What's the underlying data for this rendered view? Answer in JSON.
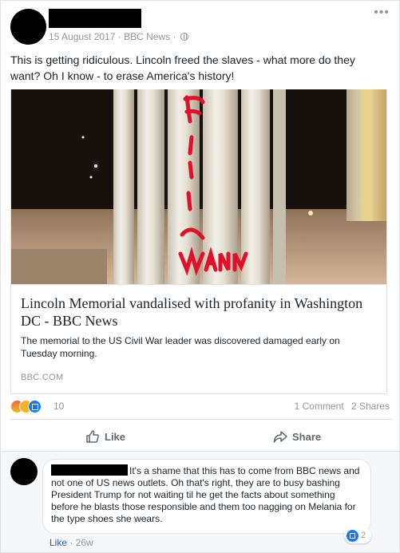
{
  "post": {
    "timestamp": "15 August 2017",
    "source": "BBC News",
    "separator": "·",
    "more_icon": "more-options-icon",
    "text": "This is getting ridiculous. Lincoln freed the slaves - what more do they want? Oh I know - to erase America's history!"
  },
  "link": {
    "title": "Lincoln Memorial vandalised with profanity in Washington DC - BBC News",
    "description": "The memorial to the US Civil War leader was discovered damaged early on Tuesday morning.",
    "domain": "BBC.COM"
  },
  "stats": {
    "reactions": [
      "angry",
      "sad",
      "like"
    ],
    "reaction_count": "10",
    "comments": "1 Comment",
    "shares": "2 Shares"
  },
  "actions": {
    "like_label": "Like",
    "share_label": "Share"
  },
  "comment": {
    "text": "It's a shame that this has to come from BBC news and not one of US news outlets. Oh that's right, they are to busy bashing President Trump for not waiting til he get the facts about something before he blasts those responsible and them too nagging on Melania for the type shoes she wears.",
    "reaction_count": "2",
    "like_label": "Like",
    "separator": "·",
    "time": "26w"
  },
  "colors": {
    "link_blue": "#385898",
    "meta_gray": "#90949c",
    "like_blue": "#1877f2",
    "graffiti_red": "#e0102a"
  }
}
